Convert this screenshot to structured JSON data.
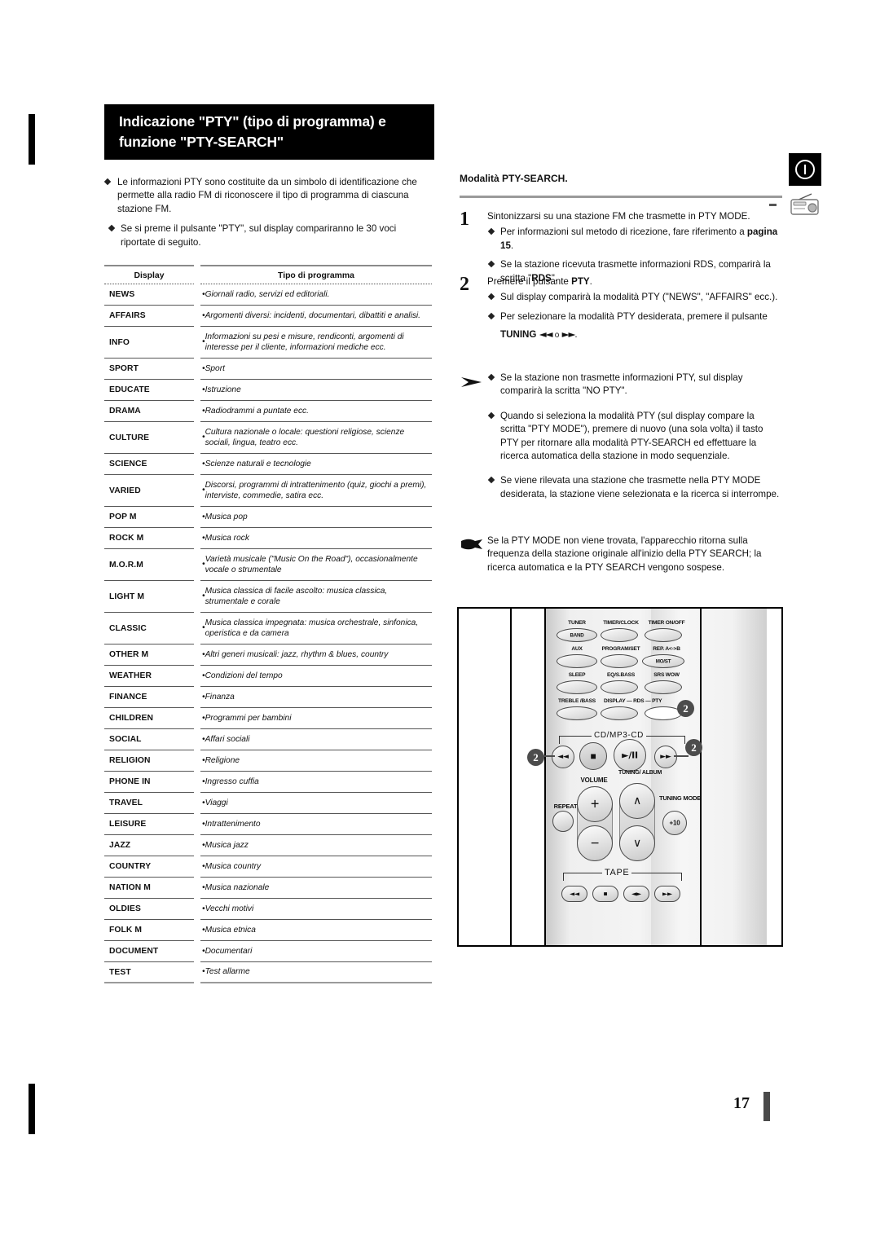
{
  "title_bar": {
    "line1": "Indicazione \"PTY\" (tipo di programma) e",
    "line2": "funzione \"PTY-SEARCH\""
  },
  "icons": {
    "power": "power-info-icon",
    "radio": "radio-tuner-icon"
  },
  "intro": {
    "bullets": [
      "Le informazioni PTY sono costituite da un simbolo di identificazione che permette alla radio FM di riconoscere il tipo di programma di ciascuna stazione FM.",
      "Se si preme il pulsante \"PTY\", sul display compariranno le 30 voci riportate di seguito."
    ]
  },
  "table": {
    "headers": [
      "Display",
      "Tipo di programma"
    ],
    "rows": [
      {
        "display": "NEWS",
        "desc": "Giornali radio, servizi ed editoriali."
      },
      {
        "display": "AFFAIRS",
        "desc": "Argomenti diversi: incidenti, documentari, dibattiti e analisi."
      },
      {
        "display": "INFO",
        "desc": "Informazioni su pesi e misure, rendiconti, argomenti di interesse per il cliente, informazioni mediche ecc."
      },
      {
        "display": "SPORT",
        "desc": "Sport"
      },
      {
        "display": "EDUCATE",
        "desc": "Istruzione"
      },
      {
        "display": "DRAMA",
        "desc": "Radiodrammi a puntate ecc."
      },
      {
        "display": "CULTURE",
        "desc": "Cultura nazionale o locale: questioni religiose, scienze sociali, lingua, teatro ecc."
      },
      {
        "display": "SCIENCE",
        "desc": "Scienze naturali e tecnologie"
      },
      {
        "display": "VARIED",
        "desc": "Discorsi, programmi di intrattenimento (quiz, giochi a premi), interviste, commedie, satira ecc."
      },
      {
        "display": "POP M",
        "desc": "Musica pop"
      },
      {
        "display": "ROCK M",
        "desc": "Musica rock"
      },
      {
        "display": "M.O.R.M",
        "desc": "Varietà musicale (\"Music On the Road\"), occasionalmente vocale o strumentale"
      },
      {
        "display": "LIGHT M",
        "desc": "Musica classica di facile ascolto: musica classica, strumentale e corale"
      },
      {
        "display": "CLASSIC",
        "desc": "Musica classica impegnata: musica orchestrale, sinfonica, operistica e da camera"
      },
      {
        "display": "OTHER M",
        "desc": "Altri generi musicali: jazz, rhythm & blues, country"
      },
      {
        "display": "WEATHER",
        "desc": "Condizioni del tempo"
      },
      {
        "display": "FINANCE",
        "desc": "Finanza"
      },
      {
        "display": "CHILDREN",
        "desc": "Programmi per bambini"
      },
      {
        "display": "SOCIAL",
        "desc": "Affari sociali"
      },
      {
        "display": "RELIGION",
        "desc": "Religione"
      },
      {
        "display": "PHONE IN",
        "desc": "Ingresso cuffia"
      },
      {
        "display": "TRAVEL",
        "desc": "Viaggi"
      },
      {
        "display": "LEISURE",
        "desc": "Intrattenimento"
      },
      {
        "display": "JAZZ",
        "desc": "Musica jazz"
      },
      {
        "display": "COUNTRY",
        "desc": "Musica country"
      },
      {
        "display": "NATION M",
        "desc": "Musica nazionale"
      },
      {
        "display": "OLDIES",
        "desc": "Vecchi motivi"
      },
      {
        "display": "FOLK M",
        "desc": "Musica etnica"
      },
      {
        "display": "DOCUMENT",
        "desc": "Documentari"
      },
      {
        "display": "TEST",
        "desc": "Test allarme"
      }
    ]
  },
  "right": {
    "heading": "Modalità PTY-SEARCH.",
    "step1": {
      "num": "1",
      "lead": "Sintonizzarsi su una stazione FM che trasmette in PTY MODE.",
      "sub1_a": "Per informazioni sul metodo di ricezione, fare riferimento a ",
      "sub1_b": "pagina 15",
      "sub1_c": ".",
      "sub2_a": "Se la stazione ricevuta trasmette informazioni RDS, comparirà la scritta \"",
      "sub2_b": "RDS",
      "sub2_c": "\"."
    },
    "step2": {
      "num": "2",
      "lead_a": "Premere il pulsante ",
      "lead_b": "PTY",
      "lead_c": ".",
      "sub1": "Sul display comparirà la modalità PTY (\"NEWS\", \"AFFAIRS\" ecc.).",
      "sub2": "Per selezionare la modalità PTY desiderata, premere il pulsante",
      "sub2_btn": "TUNING",
      "sub2_glyph1": "◄◄",
      "sub2_or": "o",
      "sub2_glyph2": "►►"
    },
    "notes": [
      "Se la stazione non trasmette informazioni PTY, sul display comparirà la scritta \"NO PTY\".",
      "Quando si seleziona la modalità PTY (sul display compare la scritta \"PTY MODE\"), premere di nuovo (una sola volta) il tasto PTY per ritornare alla modalità PTY-SEARCH ed effettuare la ricerca automatica della stazione in modo sequenziale.",
      "Se viene rilevata una stazione che trasmette nella PTY MODE desiderata, la stazione viene selezionata e la ricerca si interrompe."
    ],
    "hand_note": "Se la PTY MODE non viene trovata, l'apparecchio ritorna sulla frequenza della stazione originale all'inizio della PTY SEARCH; la ricerca automatica e la PTY SEARCH vengono sospese."
  },
  "remote": {
    "labels": {
      "tuner": "TUNER",
      "band": "BAND",
      "timer_clock": "TIMER/CLOCK",
      "timer_onoff": "TIMER ON/OFF",
      "aux": "AUX",
      "program_set": "PROGRAM/SET",
      "rep_ab": "REP. A<->B",
      "mo_st": "MO/ST",
      "sleep": "SLEEP",
      "eq_sbass": "EQ/S.BASS",
      "srs_wow": "SRS WOW",
      "treble_bass": "TREBLE /BASS",
      "display_rds_pty": "DISPLAY — RDS — PTY",
      "cd_mp3": "CD/MP3-CD",
      "prev": "◄◄",
      "stop": "■",
      "play_pause": "►/II",
      "next": "►►",
      "volume": "VOLUME",
      "plus": "+",
      "minus": "−",
      "tuning_album": "TUNING/ ALBUM",
      "up": "∧",
      "down": "∨",
      "repeat": "REPEAT",
      "tuning_mode": "TUNING MODE",
      "plus10": "+10",
      "tape": "TAPE",
      "tape_rew": "◄◄",
      "tape_stop": "■",
      "tape_dir": "◄►",
      "tape_ff": "►►"
    },
    "callouts": [
      "2",
      "2",
      "2"
    ]
  },
  "footer": {
    "page_number": "17"
  },
  "colors": {
    "title_bg": "#000000",
    "rule": "#8a8a8a",
    "callout": "#4c4c4c"
  }
}
